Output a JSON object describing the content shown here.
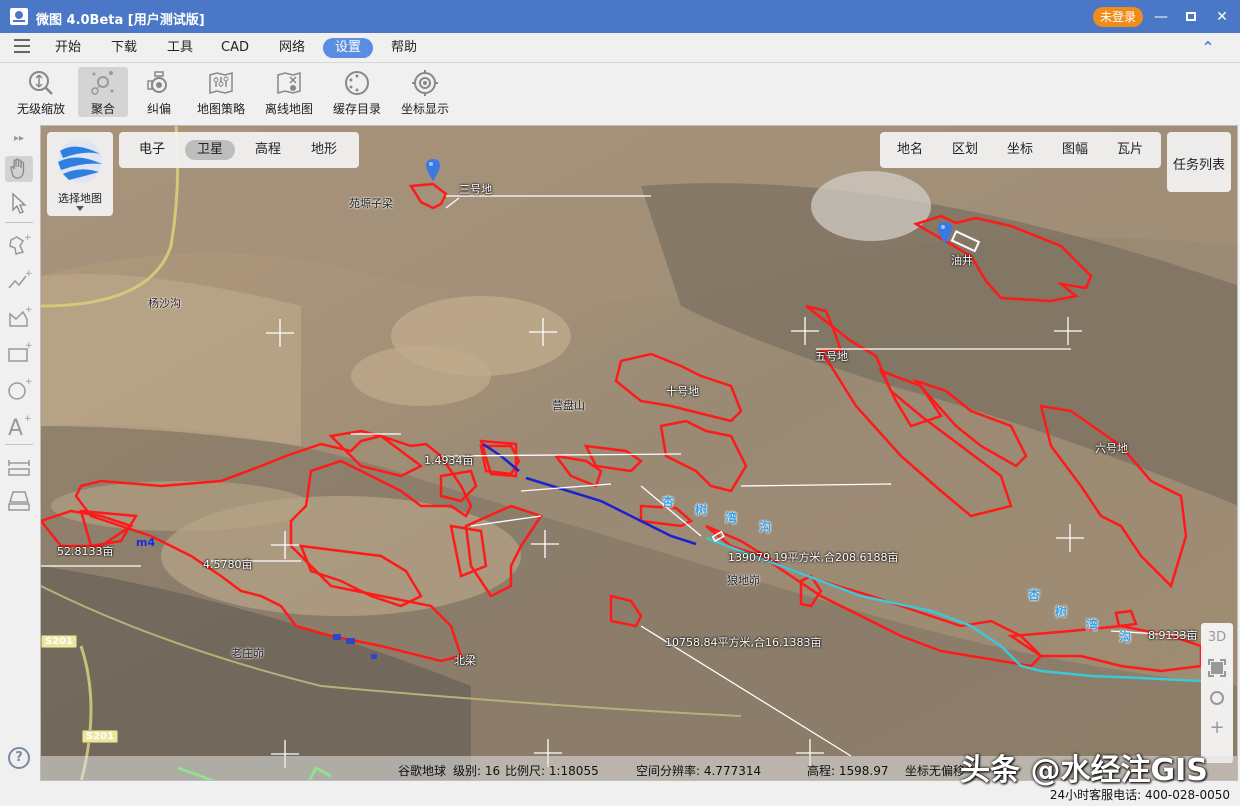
{
  "app": {
    "title": "微图 4.0Beta [用户测试版]",
    "login_badge": "未登录",
    "window_controls": [
      "minimize-icon",
      "maximize-icon",
      "close-icon"
    ]
  },
  "menu": {
    "items": [
      {
        "label": "开始",
        "active": false
      },
      {
        "label": "下载",
        "active": false
      },
      {
        "label": "工具",
        "active": false
      },
      {
        "label": "CAD",
        "active": false
      },
      {
        "label": "网络",
        "active": false
      },
      {
        "label": "设置",
        "active": true
      },
      {
        "label": "帮助",
        "active": false
      }
    ],
    "collapse_icon": "double-chevron-up-icon"
  },
  "toolbar": {
    "items": [
      {
        "label": "无级缩放",
        "icon": "zoom-stepless-icon",
        "active": false
      },
      {
        "label": "聚合",
        "icon": "cluster-icon",
        "active": true
      },
      {
        "label": "纠偏",
        "icon": "rectify-icon",
        "active": false
      },
      {
        "label": "地图策略",
        "icon": "map-strategy-icon",
        "active": false
      },
      {
        "label": "离线地图",
        "icon": "offline-map-icon",
        "active": false
      },
      {
        "label": "缓存目录",
        "icon": "cache-folder-icon",
        "active": false
      },
      {
        "label": "坐标显示",
        "icon": "coordinate-display-icon",
        "active": false
      }
    ]
  },
  "left_tools": [
    {
      "name": "expand-icon"
    },
    {
      "name": "pan-hand-icon",
      "active": true
    },
    {
      "name": "select-arrow-icon"
    },
    {
      "name": "draw-polygon-icon"
    },
    {
      "name": "draw-polyline-icon"
    },
    {
      "name": "draw-area-icon"
    },
    {
      "name": "draw-rectangle-icon"
    },
    {
      "name": "draw-circle-icon"
    },
    {
      "name": "add-text-icon"
    },
    {
      "name": "measure-distance-icon"
    },
    {
      "name": "measure-area-icon"
    }
  ],
  "map": {
    "select_map_label": "选择地图",
    "map_types": [
      {
        "label": "电子",
        "active": false
      },
      {
        "label": "卫星",
        "active": true
      },
      {
        "label": "高程",
        "active": false
      },
      {
        "label": "地形",
        "active": false
      }
    ],
    "overlays": [
      "地名",
      "区划",
      "坐标",
      "图幅",
      "瓦片"
    ],
    "task_list_label": "任务列表",
    "controls": {
      "3d": "3D",
      "fullscreen": "fullscreen-icon",
      "locate": "locate-icon",
      "zoom_in": "+"
    },
    "place_labels": [
      "苑塬子梁",
      "杨沙沟",
      "营盘山",
      "狼地峁",
      "老庄峁",
      "油井",
      "北梁"
    ],
    "field_labels": [
      "三号地",
      "五号地",
      "十号地",
      "六号地"
    ],
    "area_labels": [
      "1.4934亩",
      "52.8133亩",
      "4.5780亩",
      "139079.19平方米,合208.6188亩",
      "10758.84平方米,合16.1383亩",
      "8.9133亩"
    ],
    "river_chars": [
      "杏",
      "树",
      "湾",
      "沟"
    ],
    "m4_label": "m4",
    "road_label": "S201"
  },
  "status": {
    "source": "谷歌地球",
    "level": "级别: 16",
    "scale": "比例尺: 1:18055",
    "resolution": "空间分辨率: 4.777314",
    "elevation": "高程:  1598.97",
    "coord": "坐标无偏移"
  },
  "footer": {
    "hotline": "24小时客服电话: 400-028-0050"
  },
  "watermark": "头条 @水经注GIS",
  "colors": {
    "titlebar": "#4b78c6",
    "accent": "#5b8de0",
    "login": "#f08c1a",
    "polygon": "#ff1a1a",
    "river": "#3cc8d8",
    "line_blue": "#1a22d0"
  }
}
